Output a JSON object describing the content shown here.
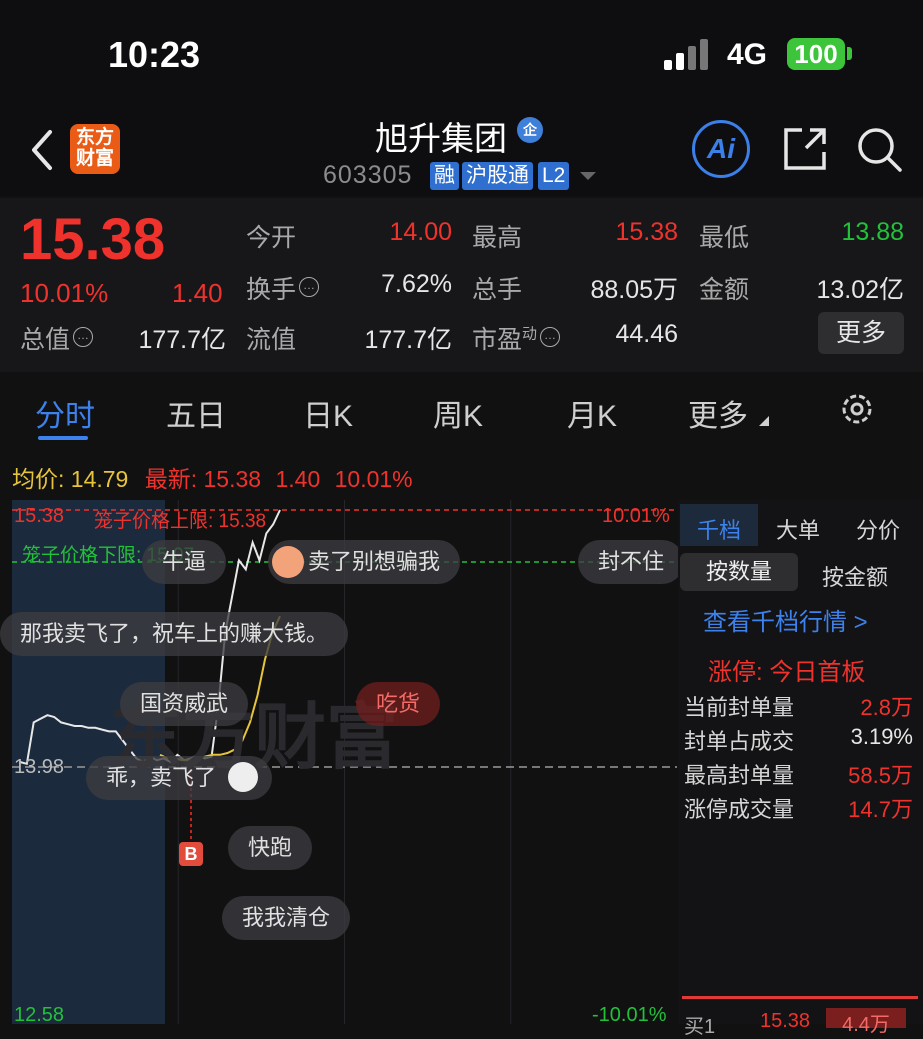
{
  "status_bar": {
    "time": "10:23",
    "network": "4G",
    "battery": "100"
  },
  "header": {
    "logo_line1": "东方",
    "logo_line2": "财富",
    "stock_name": "旭升集团",
    "state_badge": "企",
    "stock_code": "603305",
    "tags": [
      "融",
      "沪股通",
      "L2"
    ],
    "ai_label": "Ai"
  },
  "quote": {
    "price": "15.38",
    "change_pct": "10.01%",
    "change_abs": "1.40",
    "fields": {
      "open_label": "今开",
      "open": "14.00",
      "high_label": "最高",
      "high": "15.38",
      "low_label": "最低",
      "low": "13.88",
      "turnover_label": "换手",
      "turnover": "7.62%",
      "volume_label": "总手",
      "volume": "88.05万",
      "amount_label": "金额",
      "amount": "13.02亿",
      "mktcap_label": "总值",
      "mktcap": "177.7亿",
      "float_label": "流值",
      "float": "177.7亿",
      "pe_label": "市盈",
      "pe_sup": "动",
      "pe": "44.46"
    },
    "more_label": "更多"
  },
  "tabs": [
    "分时",
    "五日",
    "日K",
    "周K",
    "月K",
    "更多"
  ],
  "avg_row": {
    "avg_label": "均价:",
    "avg_value": "14.79",
    "latest_label": "最新:",
    "latest_value": "15.38",
    "latest_change": "1.40",
    "latest_pct": "10.01%"
  },
  "chart": {
    "top_price": "15.38",
    "top_pct": "10.01%",
    "mid_price": "13.98",
    "bottom_price": "12.58",
    "bottom_pct": "-10.01%",
    "cage_upper_label": "笼子价格上限: 15.38",
    "cage_lower_label": "笼子价格下限: 15.07",
    "buy_marker": "B",
    "watermark": "东方财富",
    "colors": {
      "up": "#f0322d",
      "down": "#22c13a",
      "price_line": "#e8e8e8",
      "avg_line": "#e6c43c",
      "accent": "#3d82ec"
    }
  },
  "chart_data": {
    "type": "line",
    "series": [
      {
        "values": [
          13.98,
          13.97,
          14.2,
          14.22,
          14.24,
          14.23,
          14.2,
          14.19,
          14.18,
          14.18,
          14.17,
          14.17,
          14.16,
          14.15,
          14.15,
          14.1,
          14.05,
          14.0,
          13.98,
          14.01,
          13.99,
          14.0,
          13.98,
          14.02,
          13.99,
          14.0,
          14.02,
          14.0,
          14.01,
          14.3,
          14.7,
          14.9,
          15.1,
          15.05,
          15.2,
          15.1,
          15.25,
          15.3,
          15.38
        ]
      },
      {
        "values": [
          14.02,
          14.0,
          14.0,
          13.99,
          13.99,
          14.0,
          14.01,
          14.02,
          14.02,
          14.03,
          14.05,
          14.1,
          14.2,
          14.35,
          14.55,
          14.7,
          14.79
        ]
      }
    ],
    "ylim": [
      12.58,
      15.38
    ]
  },
  "bubbles": [
    {
      "text": "牛逼",
      "red": false
    },
    {
      "text": "卖了别想骗我",
      "red": false
    },
    {
      "text": "封不住",
      "red": false
    },
    {
      "text": "那我卖飞了，祝车上的赚大钱。",
      "red": false
    },
    {
      "text": "国资威武",
      "red": false
    },
    {
      "text": "吃货",
      "red": true
    },
    {
      "text": "乖，卖飞了",
      "red": false
    },
    {
      "text": "快跑",
      "red": false
    },
    {
      "text": "我我清仓",
      "red": false
    }
  ],
  "right_panel": {
    "tabs": [
      "千档",
      "大单",
      "分价"
    ],
    "sub_tabs": [
      "按数量",
      "按金额"
    ],
    "link": "查看千档行情 >",
    "limit_title": "涨停: 今日首板",
    "rows": [
      {
        "label": "当前封单量",
        "value": "2.8万"
      },
      {
        "label": "封单占成交",
        "value": "3.19%"
      },
      {
        "label": "最高封单量",
        "value": "58.5万"
      },
      {
        "label": "涨停成交量",
        "value": "14.7万"
      }
    ],
    "book_label": "买1",
    "book_price": "15.38",
    "book_qty": "4.4万"
  }
}
